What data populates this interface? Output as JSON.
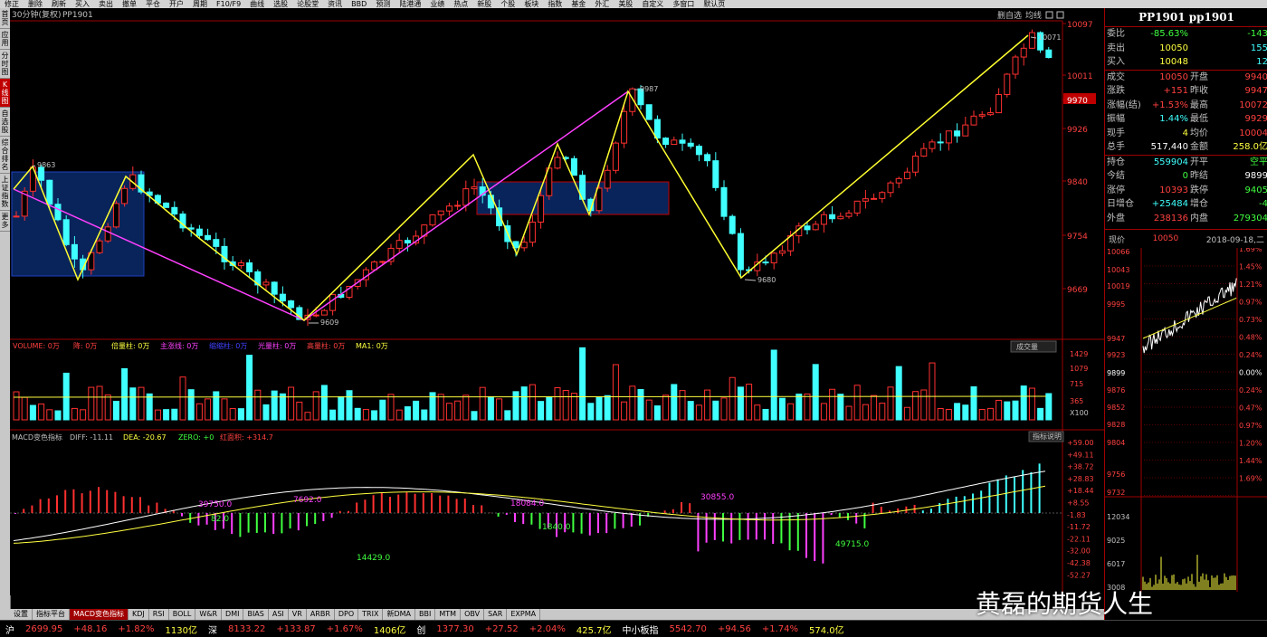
{
  "toolbar": [
    "修正",
    "删除",
    "刷新",
    "买入",
    "卖出",
    "撤单",
    "平仓",
    "开户",
    "周期",
    "F10/F9",
    "曲线",
    "选股",
    "论股堂",
    "资讯",
    "BBD",
    "预测",
    "陆港通",
    "业绩",
    "热点",
    "新股",
    "个股",
    "板块",
    "指数",
    "基金",
    "外汇",
    "美股",
    "自定义",
    "多窗口",
    "默认页"
  ],
  "sidebar": [
    "首页",
    "应用",
    "分时图",
    "K线图",
    "自选股",
    "综合排名",
    "上证指数",
    "更多"
  ],
  "chart": {
    "header_left": "30分钟(复权)",
    "symbol": "PP1901",
    "header_right_a": "删自选",
    "header_right_b": "均线",
    "price_axis": [
      "10097",
      "10011",
      "9970",
      "9926",
      "9840",
      "9754",
      "9669"
    ],
    "annotations": [
      "9863",
      "9609",
      "9987",
      "9680",
      "10071"
    ],
    "vol_title": "VOLUME: 0万",
    "vol_items": [
      "降: 0万",
      "倍量柱: 0万",
      "主涨线: 0万",
      "缩缩柱: 0万",
      "光量柱: 0万",
      "高量柱: 0万",
      "MA1: 0万"
    ],
    "vol_btn": "成交量",
    "vol_axis": [
      "1429",
      "1079",
      "715",
      "365",
      "X100"
    ],
    "macd_title": "MACD变色指标",
    "macd_diff": "DIFF: -11.11",
    "macd_dea": "DEA: -20.67",
    "macd_zero": "ZERO: +0",
    "macd_red": "红面积: +314.7",
    "macd_btn": "指标说明",
    "macd_axis": [
      "+59.00",
      "+49.11",
      "+38.72",
      "+28.83",
      "+18.44",
      "+8.55",
      "-1.83",
      "-11.72",
      "-22.11",
      "-32.00",
      "-42.38",
      "-52.27"
    ],
    "macd_labels": [
      "39750.0",
      "82.0",
      "7692.0",
      "14429.0",
      "18084.0",
      "1840.0",
      "30855.0",
      "49715.0"
    ],
    "time_labels": [
      "15.00",
      "18-08-28 11:15",
      "15.00",
      "15.00",
      "15.00",
      "15.00",
      "15.00"
    ]
  },
  "panel": {
    "title": "PP1901 pp1901",
    "rows": [
      {
        "l": "委比",
        "v": "-85.63%",
        "vc": "green",
        "l2": "",
        "v2": "-143",
        "v2c": "green"
      },
      {
        "l": "卖出",
        "v": "10050",
        "vc": "yellow",
        "l2": "",
        "v2": "155",
        "v2c": "cyan"
      },
      {
        "l": "买入",
        "v": "10048",
        "vc": "yellow",
        "l2": "",
        "v2": "12",
        "v2c": "cyan"
      },
      {
        "l": "成交",
        "v": "10050",
        "vc": "red",
        "l2": "开盘",
        "v2": "9940",
        "v2c": "red"
      },
      {
        "l": "涨跌",
        "v": "+151",
        "vc": "red",
        "l2": "昨收",
        "v2": "9947",
        "v2c": "red"
      },
      {
        "l": "涨幅(结)",
        "v": "+1.53%",
        "vc": "red",
        "l2": "最高",
        "v2": "10072",
        "v2c": "red"
      },
      {
        "l": "振幅",
        "v": "1.44%",
        "vc": "cyan",
        "l2": "最低",
        "v2": "9929",
        "v2c": "red"
      },
      {
        "l": "现手",
        "v": "4",
        "vc": "yellow",
        "l2": "均价",
        "v2": "10004",
        "v2c": "red"
      },
      {
        "l": "总手",
        "v": "517,440",
        "vc": "white",
        "l2": "金额",
        "v2": "258.0亿",
        "v2c": "yellow"
      },
      {
        "l": "持仓",
        "v": "559904",
        "vc": "cyan",
        "l2": "开平",
        "v2": "空平",
        "v2c": "green"
      },
      {
        "l": "今结",
        "v": "0",
        "vc": "green",
        "l2": "昨结",
        "v2": "9899",
        "v2c": "white"
      },
      {
        "l": "涨停",
        "v": "10393",
        "vc": "red",
        "l2": "跌停",
        "v2": "9405",
        "v2c": "green"
      },
      {
        "l": "日增仓",
        "v": "+25484",
        "vc": "cyan",
        "l2": "增仓",
        "v2": "-4",
        "v2c": "green"
      },
      {
        "l": "外盘",
        "v": "238136",
        "vc": "red",
        "l2": "内盘",
        "v2": "279304",
        "v2c": "green"
      }
    ],
    "now_label": "现价",
    "now_value": "10050",
    "date": "2018-09-18,二",
    "mini_prices": [
      "10066",
      "10043",
      "10019",
      "9995",
      "9947",
      "9923",
      "9899",
      "9876",
      "9852",
      "9828",
      "9804",
      "9756",
      "9732"
    ],
    "mini_pcts": [
      "1.69%",
      "1.45%",
      "1.21%",
      "0.97%",
      "0.73%",
      "0.48%",
      "0.24%",
      "0.00%",
      "0.24%",
      "0.47%",
      "0.97%",
      "1.20%",
      "1.44%",
      "1.69%"
    ],
    "mini_vols": [
      "12034",
      "9025",
      "6017",
      "3008"
    ]
  },
  "bottom_tabs": [
    "设置",
    "指标平台",
    "MACD变色指标",
    "KDJ",
    "RSI",
    "BOLL",
    "W&R",
    "DMI",
    "BIAS",
    "ASI",
    "VR",
    "ARBR",
    "DPO",
    "TRIX",
    "新DMA",
    "BBI",
    "MTM",
    "OBV",
    "SAR",
    "EXPMA"
  ],
  "status": [
    {
      "t": "沪",
      "c": "white"
    },
    {
      "t": "2699.95",
      "c": "red"
    },
    {
      "t": "+48.16",
      "c": "red"
    },
    {
      "t": "+1.82%",
      "c": "red"
    },
    {
      "t": "1130亿",
      "c": "yellow"
    },
    {
      "t": "深",
      "c": "white"
    },
    {
      "t": "8133.22",
      "c": "red"
    },
    {
      "t": "+133.87",
      "c": "red"
    },
    {
      "t": "+1.67%",
      "c": "red"
    },
    {
      "t": "1406亿",
      "c": "yellow"
    },
    {
      "t": "创",
      "c": "white"
    },
    {
      "t": "1377.30",
      "c": "red"
    },
    {
      "t": "+27.52",
      "c": "red"
    },
    {
      "t": "+2.04%",
      "c": "red"
    },
    {
      "t": "425.7亿",
      "c": "yellow"
    },
    {
      "t": "中小板指",
      "c": "white"
    },
    {
      "t": "5542.70",
      "c": "red"
    },
    {
      "t": "+94.56",
      "c": "red"
    },
    {
      "t": "+1.74%",
      "c": "red"
    },
    {
      "t": "574.0亿",
      "c": "yellow"
    }
  ],
  "watermark": "黄磊的期货人生"
}
